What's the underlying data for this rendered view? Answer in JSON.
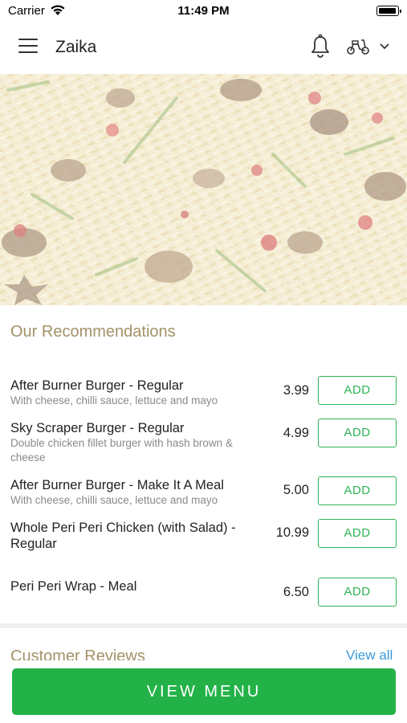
{
  "status_bar": {
    "carrier": "Carrier",
    "time": "11:49 PM"
  },
  "app_bar": {
    "title": "Zaika",
    "icons": [
      "menu-icon",
      "bell-icon",
      "scooter-icon",
      "chevron-down-icon"
    ]
  },
  "hero": {
    "image": "biryani rice dish photo"
  },
  "recommendations": {
    "title": "Our Recommendations",
    "items": [
      {
        "name": "After Burner Burger - Regular",
        "description": "With cheese, chilli sauce, lettuce and mayo",
        "price": "3.99",
        "action": "ADD"
      },
      {
        "name": "Sky Scraper Burger - Regular",
        "description": "Double chicken fillet burger with hash brown & cheese",
        "price": "4.99",
        "action": "ADD"
      },
      {
        "name": "After Burner Burger - Make It A Meal",
        "description": "With cheese, chilli sauce, lettuce and mayo",
        "price": "5.00",
        "action": "ADD"
      },
      {
        "name": "Whole Peri Peri Chicken (with Salad) - Regular",
        "description": "",
        "price": "10.99",
        "action": "ADD"
      },
      {
        "name": "Peri Peri Wrap - Meal",
        "description": "",
        "price": "6.50",
        "action": "ADD"
      }
    ]
  },
  "reviews": {
    "title": "Customer Reviews",
    "view_all": "View all"
  },
  "footer": {
    "view_menu": "VIEW MENU"
  },
  "colors": {
    "accent_green": "#23b247",
    "section_title": "#a39167",
    "link_blue": "#3a9bd9"
  }
}
